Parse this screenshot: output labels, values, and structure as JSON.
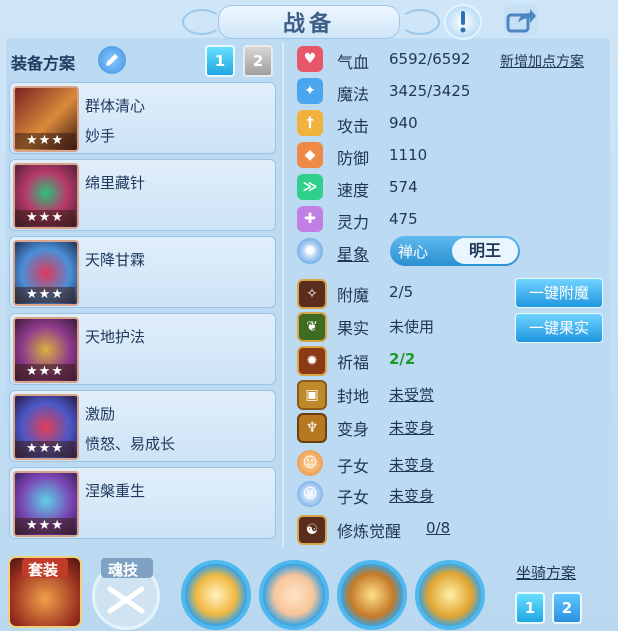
{
  "header": {
    "title": "战备"
  },
  "top_icons": [
    {
      "icon": "exclamation-icon"
    },
    {
      "icon": "share-icon"
    }
  ],
  "equipment": {
    "title": "装备方案",
    "plan_buttons": [
      {
        "label": "1",
        "active": true
      },
      {
        "label": "2",
        "active": false
      }
    ]
  },
  "skills": [
    {
      "name": "群体清心",
      "sub": "妙手",
      "stars": "★★★"
    },
    {
      "name": "绵里藏针",
      "sub": "",
      "stars": "★★★"
    },
    {
      "name": "天降甘霖",
      "sub": "",
      "stars": "★★★"
    },
    {
      "name": "天地护法",
      "sub": "",
      "stars": "★★★"
    },
    {
      "name": "激励",
      "sub": "愤怒、易成长",
      "stars": "★★★"
    },
    {
      "name": "涅槃重生",
      "sub": "",
      "stars": "★★★"
    }
  ],
  "stats": {
    "add_points_label": "新增加点方案",
    "rows": [
      {
        "label": "气血",
        "value": "6592/6592",
        "icon": "heart-icon",
        "color": "#e8566a"
      },
      {
        "label": "魔法",
        "value": "3425/3425",
        "icon": "magic-icon",
        "color": "#4aa6ef"
      },
      {
        "label": "攻击",
        "value": "940",
        "icon": "attack-icon",
        "color": "#f0b23a"
      },
      {
        "label": "防御",
        "value": "1110",
        "icon": "defense-icon",
        "color": "#ee8a46"
      },
      {
        "label": "速度",
        "value": "574",
        "icon": "speed-icon",
        "color": "#2fcf8c"
      },
      {
        "label": "灵力",
        "value": "475",
        "icon": "spirit-icon",
        "color": "#c27fe3"
      }
    ],
    "star": {
      "label": "星象",
      "options": [
        "禅心",
        "明王"
      ],
      "selected": "明王"
    }
  },
  "extras": [
    {
      "label": "附魔",
      "value": "2/5",
      "icon": "enchant-icon"
    },
    {
      "label": "果实",
      "value": "未使用",
      "icon": "fruit-icon"
    },
    {
      "label": "祈福",
      "value": "2/2",
      "icon": "blessing-icon"
    },
    {
      "label": "封地",
      "value": "未受赏",
      "icon": "fief-icon"
    },
    {
      "label": "变身",
      "value": "未变身",
      "icon": "transform-icon"
    },
    {
      "label": "子女",
      "value": "未变身",
      "icon": "child-icon"
    },
    {
      "label": "子女",
      "value": "未变身",
      "icon": "child-icon-2"
    },
    {
      "label": "修炼觉醒",
      "value": "0/8",
      "icon": "cultivation-icon"
    }
  ],
  "actions": {
    "enchant_all": "一键附魔",
    "fruit_all": "一键果实"
  },
  "bottom": {
    "equip_set": "套装",
    "soul_skill": "魂技",
    "mount": {
      "title": "坐骑方案",
      "buttons": [
        "1",
        "2"
      ]
    }
  }
}
